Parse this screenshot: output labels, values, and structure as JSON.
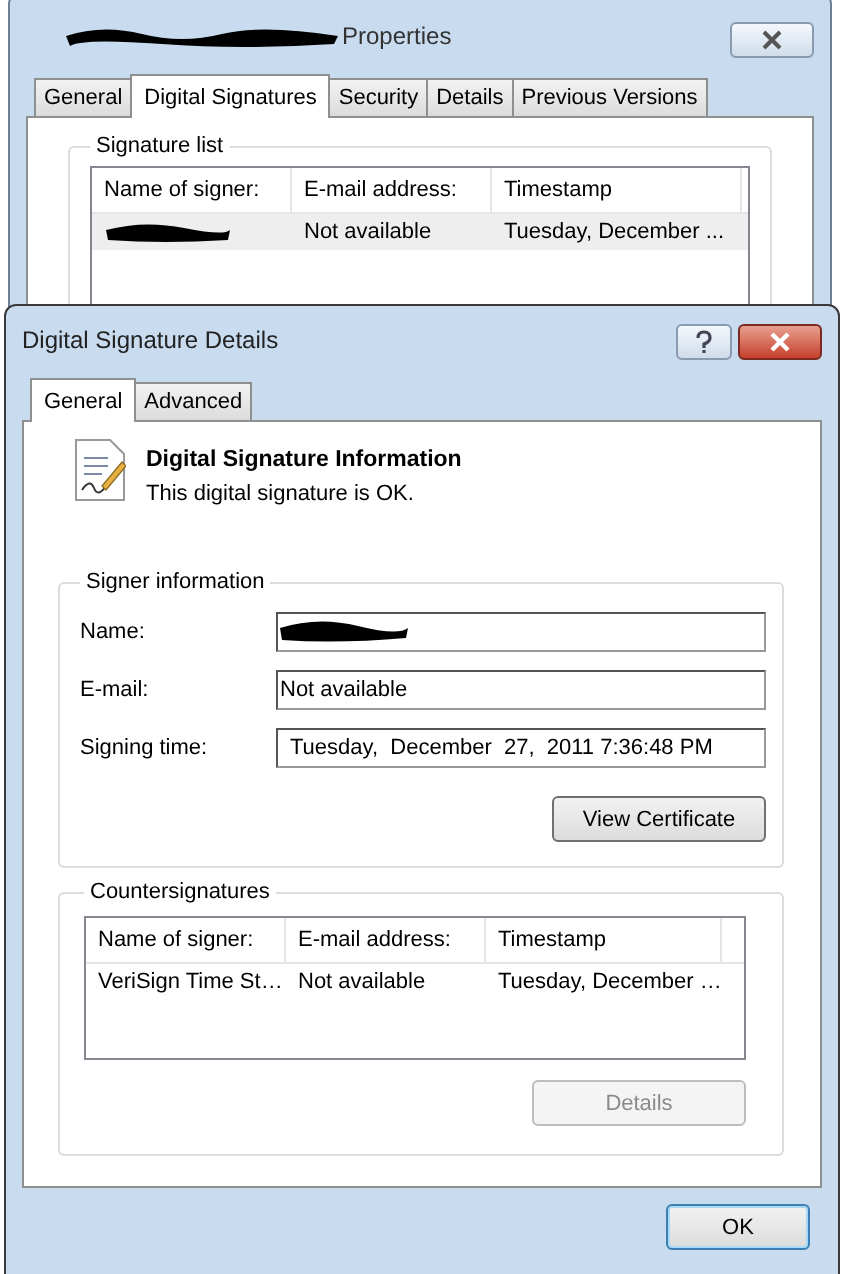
{
  "back_window": {
    "title": "Properties",
    "title_redacted": true,
    "tabs": [
      {
        "label": "General",
        "selected": false
      },
      {
        "label": "Digital Signatures",
        "selected": true
      },
      {
        "label": "Security",
        "selected": false
      },
      {
        "label": "Details",
        "selected": false
      },
      {
        "label": "Previous Versions",
        "selected": false
      }
    ],
    "signature_list": {
      "legend": "Signature list",
      "columns": [
        "Name of signer:",
        "E-mail address:",
        "Timestamp"
      ],
      "rows": [
        {
          "cells": [
            {
              "redacted": true
            },
            {
              "text": "Not available"
            },
            {
              "text": "Tuesday, December ..."
            }
          ]
        }
      ]
    }
  },
  "dialog": {
    "title": "Digital Signature Details",
    "tabs": [
      {
        "label": "General",
        "selected": true
      },
      {
        "label": "Advanced",
        "selected": false
      }
    ],
    "info": {
      "heading": "Digital Signature Information",
      "status": "This digital signature is OK."
    },
    "signer": {
      "legend": "Signer information",
      "fields": [
        {
          "label": "Name:",
          "redacted": true
        },
        {
          "label": "E-mail:",
          "value": "Not available"
        },
        {
          "label": "Signing time:",
          "value": "Tuesday,  December  27,  2011 7:36:48 PM"
        }
      ],
      "button": {
        "label": "View Certificate",
        "disabled": false
      }
    },
    "countersignatures": {
      "legend": "Countersignatures",
      "columns": [
        "Name of signer:",
        "E-mail address:",
        "Timestamp"
      ],
      "rows": [
        {
          "cells": [
            "VeriSign Time St…",
            "Not available",
            "Tuesday, December …"
          ]
        }
      ],
      "button": {
        "label": "Details",
        "disabled": true
      }
    },
    "ok": "OK"
  }
}
